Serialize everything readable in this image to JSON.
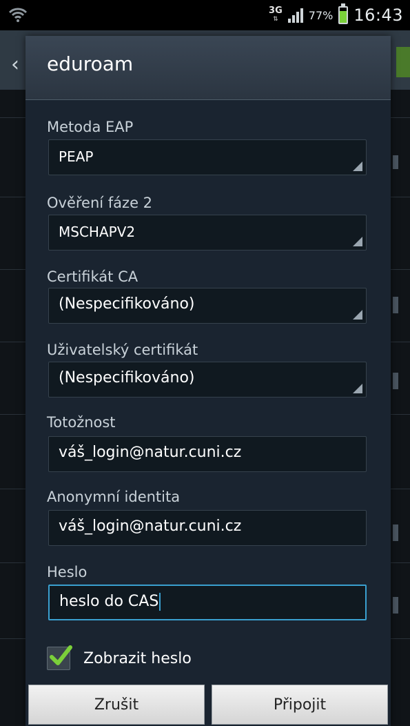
{
  "status_bar": {
    "network_type": "3G",
    "battery_percent": "77%",
    "battery_level": 0.77,
    "time": "16:43",
    "icons": [
      "wifi-icon",
      "signal-icon",
      "battery-icon"
    ]
  },
  "dialog": {
    "title": "eduroam",
    "fields": {
      "eap_method": {
        "label": "Metoda EAP",
        "value": "PEAP"
      },
      "phase2": {
        "label": "Ověření fáze 2",
        "value": "MSCHAPV2"
      },
      "ca_cert": {
        "label": "Certifikát CA",
        "value": "(Nespecifikováno)"
      },
      "user_cert": {
        "label": "Uživatelský certifikát",
        "value": "(Nespecifikováno)"
      },
      "identity": {
        "label": "Totožnost",
        "value": "váš_login@natur.cuni.cz"
      },
      "anon_identity": {
        "label": "Anonymní identita",
        "value": "váš_login@natur.cuni.cz"
      },
      "password": {
        "label": "Heslo",
        "value": "heslo do CAS"
      }
    },
    "show_password": {
      "label": "Zobrazit heslo",
      "checked": true
    },
    "buttons": {
      "cancel": "Zrušit",
      "connect": "Připojit"
    }
  },
  "colors": {
    "accent_focus": "#3aa0d0",
    "check": "#7bd03a"
  }
}
